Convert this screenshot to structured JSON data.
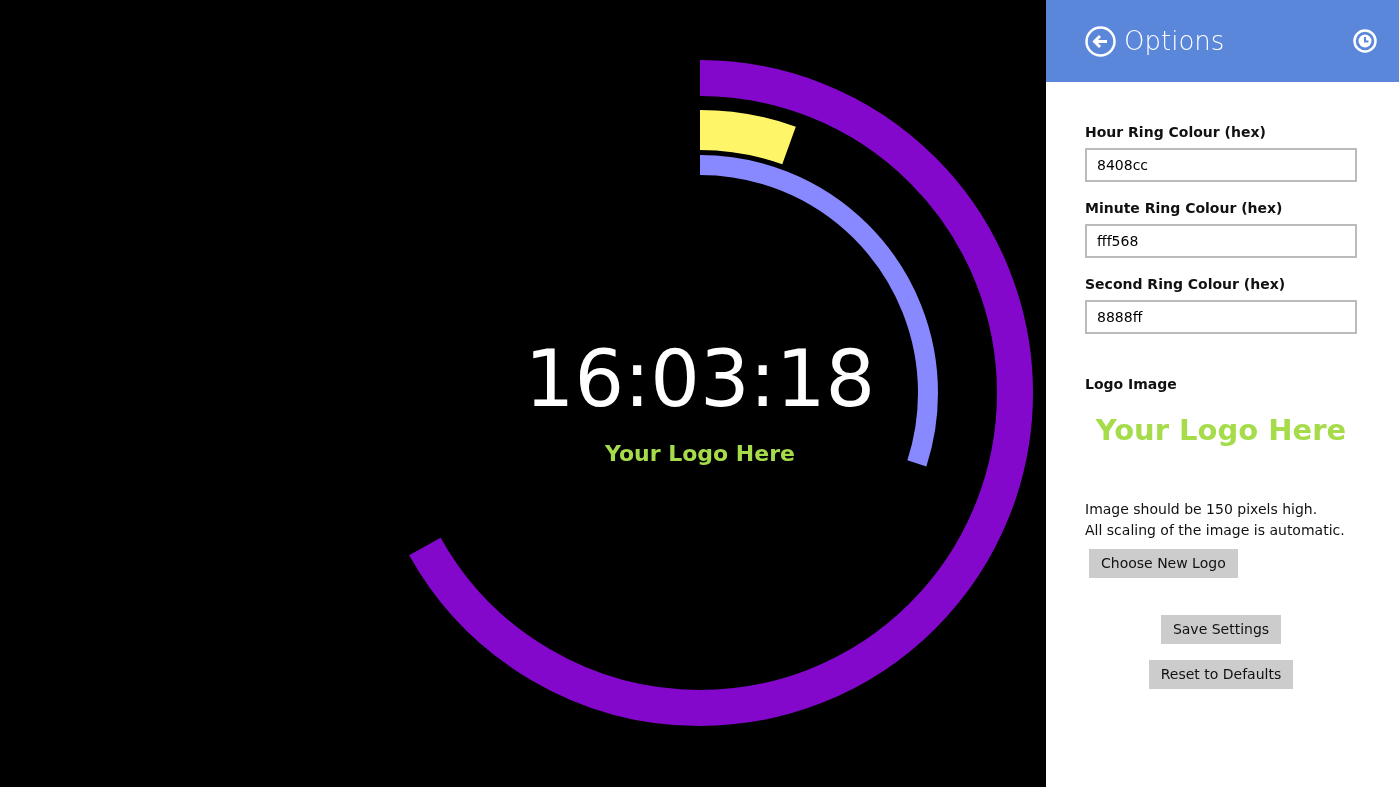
{
  "clock": {
    "time": "16:03:18",
    "logo_text": "Your Logo Here",
    "rings": [
      {
        "kind": "hour",
        "color": "#8408cc",
        "level": 0.669
      },
      {
        "kind": "minute",
        "color": "#fff568",
        "level": 0.055
      },
      {
        "kind": "second",
        "color": "#8888ff",
        "level": 0.3
      }
    ]
  },
  "options": {
    "title": "Options",
    "fields": [
      {
        "label": "Hour Ring Colour (hex)",
        "value": "8408cc"
      },
      {
        "label": "Minute Ring Colour (hex)",
        "value": "fff568"
      },
      {
        "label": "Second Ring Colour (hex)",
        "value": "8888ff"
      }
    ],
    "logo_label": "Logo Image",
    "logo_text": "Your Logo Here",
    "hint_lines": [
      "Image should be 150 pixels high.",
      "All scaling of the image is automatic."
    ],
    "choose_button": "Choose New Logo",
    "save_button": "Save Settings",
    "reset_button": "Reset to Defaults"
  }
}
